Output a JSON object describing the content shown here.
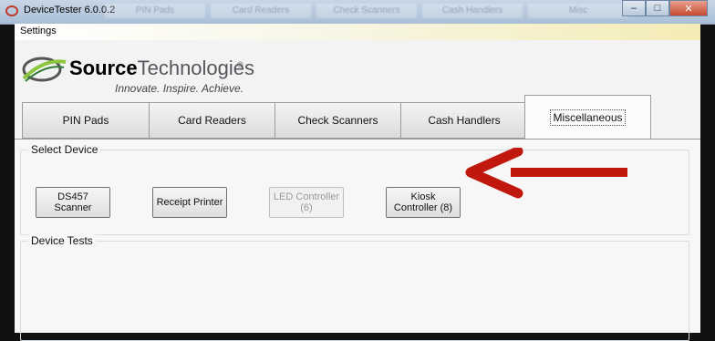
{
  "window": {
    "title": "DeviceTester 6.0.0.2",
    "taskbar_ghosts": [
      "PIN Pads",
      "Card Readers",
      "Check Scanners",
      "Cash Handlers",
      "Misc"
    ],
    "controls": {
      "minimize": "–",
      "maximize": "□",
      "close": "✕"
    }
  },
  "menu": {
    "settings": "Settings"
  },
  "logo": {
    "brand_bold": "Source",
    "brand_rest": "Technologies",
    "registered": "®",
    "tagline": "Innovate. Inspire. Achieve."
  },
  "tabs": [
    "PIN Pads",
    "Card Readers",
    "Check Scanners",
    "Cash Handlers",
    "Miscellaneous"
  ],
  "active_tab": "Miscellaneous",
  "select_device": {
    "label": "Select Device",
    "buttons": [
      {
        "label": "DS457\nScanner",
        "enabled": true
      },
      {
        "label": "Receipt Printer",
        "enabled": true
      },
      {
        "label": "LED Controller\n(6)",
        "enabled": false
      },
      {
        "label": "Kiosk\nController (8)",
        "enabled": true
      }
    ]
  },
  "device_tests": {
    "label": "Device Tests"
  },
  "colors": {
    "arrow": "#c0180c",
    "logo_accent": "#8cc63f"
  }
}
